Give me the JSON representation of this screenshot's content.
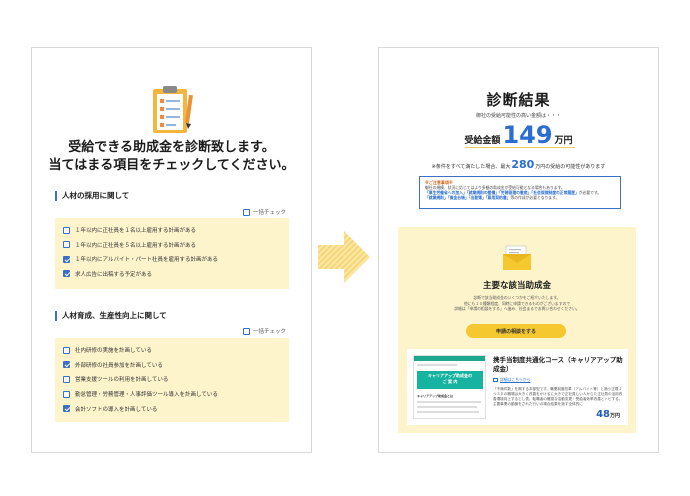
{
  "left": {
    "title_line1": "受給できる助成金を診断致します。",
    "title_line2": "当てはまる項目をチェックしてください。",
    "sections": [
      {
        "heading": "人材の採用に関して",
        "check_all": "一括チェック",
        "items": [
          {
            "label": "１年以内に正社員を１名以上雇用する計画がある",
            "checked": false
          },
          {
            "label": "１年以内に正社員を５名以上雇用する計画がある",
            "checked": false
          },
          {
            "label": "１年以内にアルバイト・パート社員を雇用する計画がある",
            "checked": true
          },
          {
            "label": "求人広告に出稿する予定がある",
            "checked": true
          }
        ]
      },
      {
        "heading": "人材育成、生産性向上に関して",
        "check_all": "一括チェック",
        "items": [
          {
            "label": "社内研修の実施を計画している",
            "checked": false
          },
          {
            "label": "外部研修の社員参加を計画している",
            "checked": true
          },
          {
            "label": "営業支援ツールの利用を計画している",
            "checked": false
          },
          {
            "label": "勤怠管理・労務管理・人事評価ツール導入を計画している",
            "checked": false
          },
          {
            "label": "会計ソフトの導入を計画している",
            "checked": true
          }
        ]
      }
    ]
  },
  "right": {
    "title": "診断結果",
    "subtitle": "御社の受給可能性の高い金額は・・・",
    "amount_label": "受給金額",
    "amount_value": "149",
    "amount_unit": "万円",
    "max_prefix": "※条件をすべて満たした場合、最大",
    "max_value": "280",
    "max_suffix": "万円の受給の可能性があります",
    "notice_title": "※ご注意事項※",
    "notice_line1": "御社の規模、状況に応じてはより多額の助成金が受給可能となる場合もあります。",
    "notice_line2_hl": "「厚生労働省への加入」「就業規則の整備」「労務管理の徹底」「社会保険制度の正常履歴」",
    "notice_line2_rest": "が必要です。",
    "notice_line3_hl": "「就業規則」「賃金台帳」「出勤簿」「雇用契約書」",
    "notice_line3_rest": "等の作成が必要となります。",
    "main_title": "主要な該当助成金",
    "main_text1": "診断で該当助成金のいくつかをご紹介いたします。",
    "main_text2": "他にも１０種類程度、同時に申請できるものがございますので",
    "main_text3": "詳細は「申請の相談をする」へ進み、社会まるでお問い合わせください。",
    "consult_button": "申請の相談をする",
    "card": {
      "title": "携手当制度共通化コース（キャリアアップ助成金）",
      "link_text": "詳細はこちらから",
      "thumb_line1": "キャリアアップ助成金の",
      "thumb_line2": "ご 案 内",
      "thumb_caption": "キャリアアップ助成金とは",
      "desc": "「不満件数」を期する本部型です。職業制度改革（アルバイト等）と適う正規１つ３０の職場は大きく改善をかけるに大きで正社員しい人からた正社員の活用改善環境向上するとし表。転職者の確認な活動変更・受給者効率改善とトピする。主要事業の動機をされた行いの場合結果を指す全体的に",
      "amount": "48",
      "amount_unit": "万円"
    }
  },
  "icons": {
    "clipboard": "clipboard-icon",
    "arrow": "right-arrow-icon",
    "envelope": "envelope-icon"
  },
  "colors": {
    "accent_blue": "#3c70c4",
    "yellow_bg": "#fdf4cc",
    "button_yellow": "#f5c830",
    "amount_blue": "#2a6ed1"
  }
}
